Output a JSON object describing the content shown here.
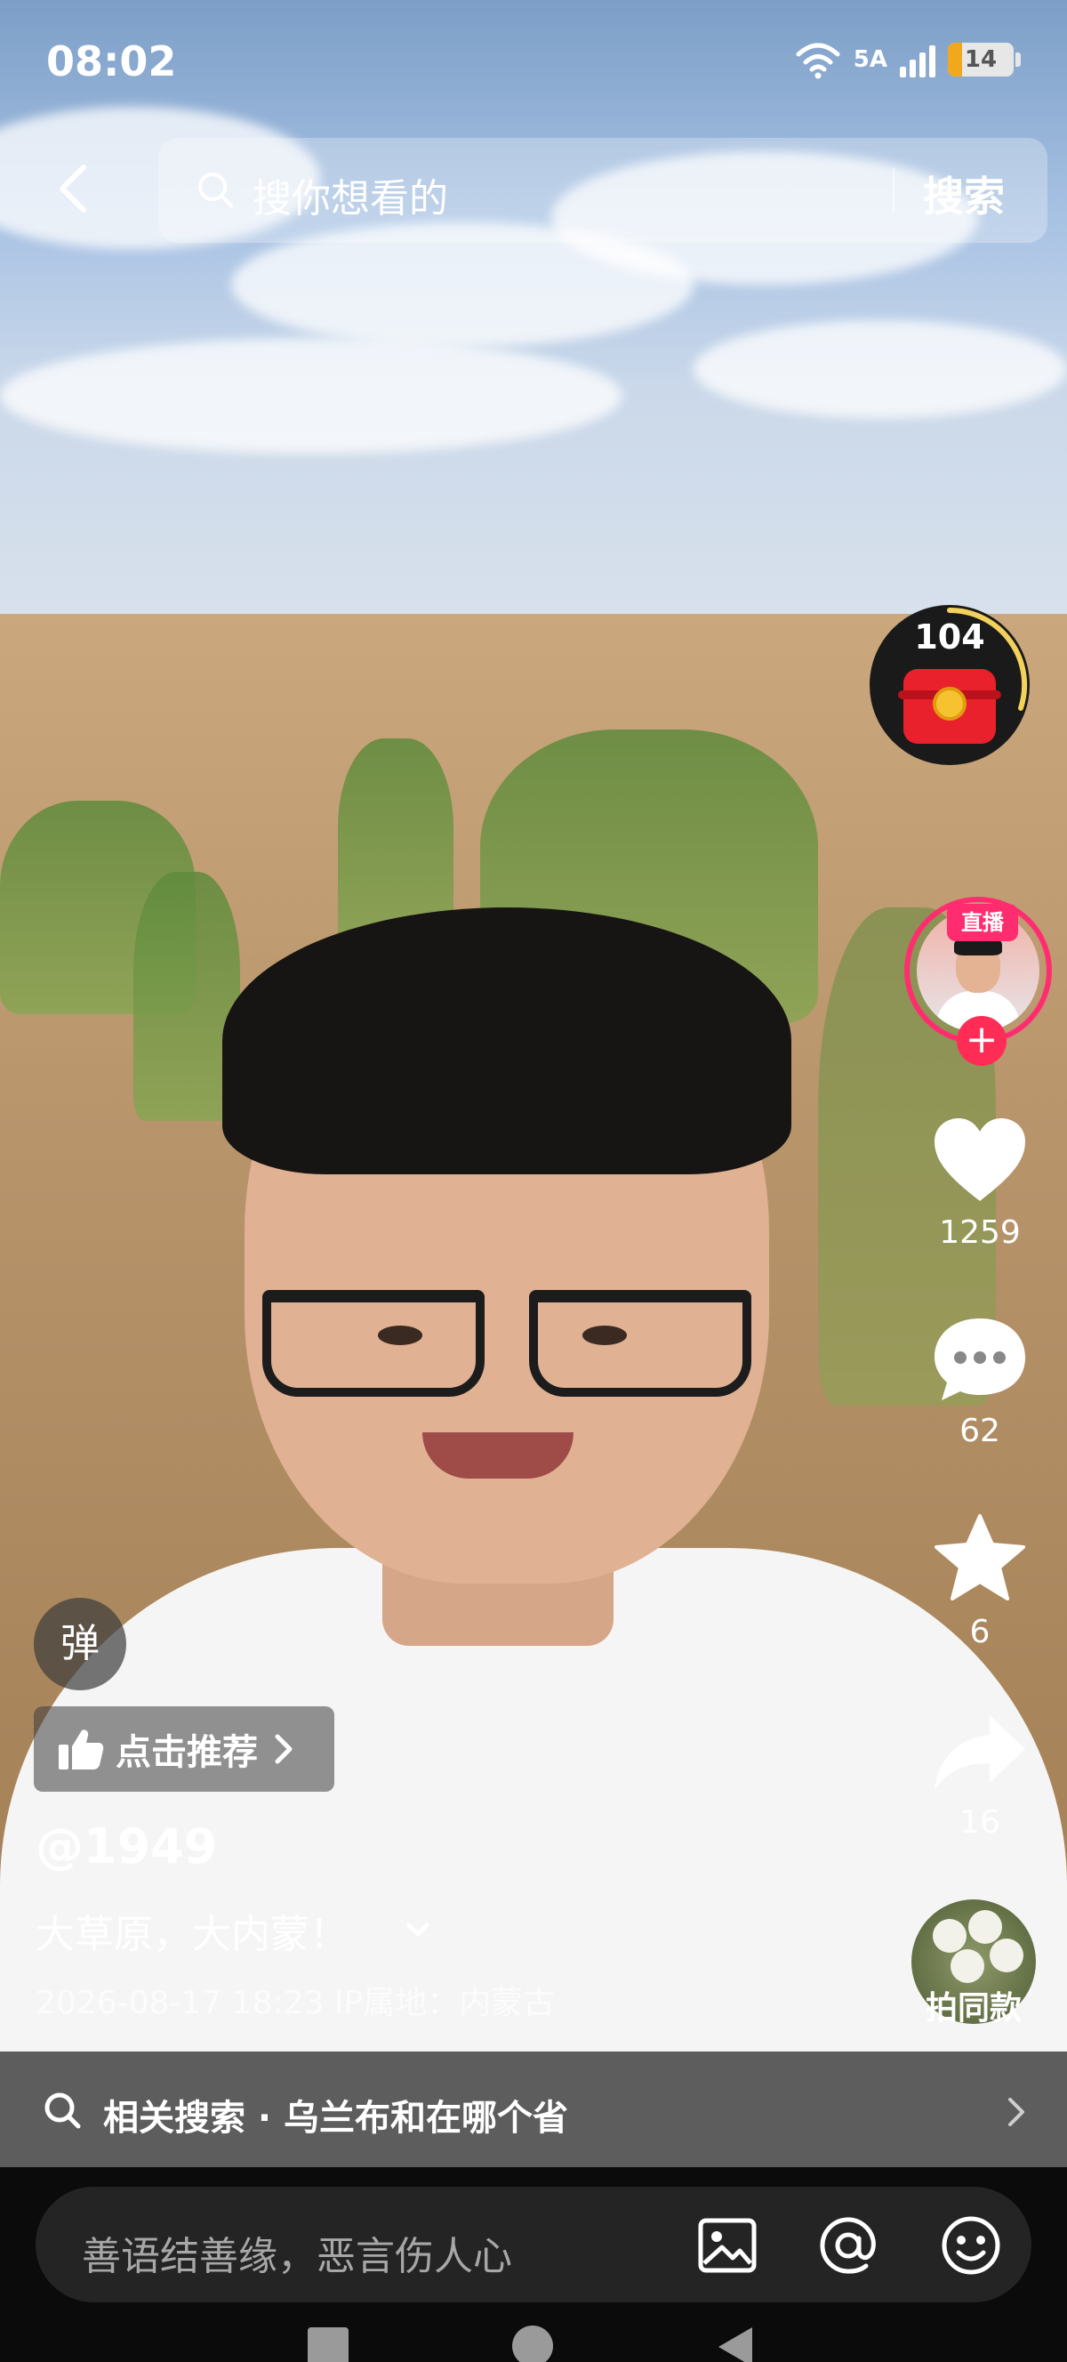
{
  "status_bar": {
    "time": "08:02",
    "network": "5A",
    "wifi_icon": "wifi-6-icon",
    "battery_level": "14",
    "battery_color": "#f2a81d"
  },
  "search": {
    "placeholder": "搜你想看的",
    "submit_label": "搜索"
  },
  "right_rail": {
    "red_packet_count": "104",
    "live_badge": "直播",
    "follow_symbol": "+",
    "likes": "1259",
    "comments": "62",
    "favorites": "6",
    "shares": "16",
    "same_style_label": "拍同款",
    "accent_color": "#ff2d6f"
  },
  "caption": {
    "danmaku_label": "弹",
    "recommend_label": "点击推荐",
    "author": "@1949",
    "description": "大草原，大内蒙！",
    "meta": "2026-08-17 18:23  IP属地：内蒙古"
  },
  "related_search": {
    "text": "相关搜索 · 乌兰布和在哪个省"
  },
  "comment_bar": {
    "placeholder": "善语结善缘，恶言伤人心"
  }
}
